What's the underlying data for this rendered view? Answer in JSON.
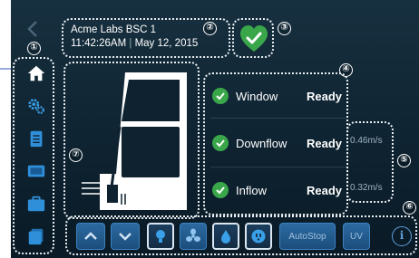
{
  "header": {
    "device_name": "Acme Labs BSC 1",
    "time": "11:42:26AM",
    "separator": "|",
    "date": "May 12, 2015"
  },
  "callouts": [
    "①",
    "②",
    "③",
    "④",
    "⑤",
    "⑥",
    "⑦"
  ],
  "sidebar": {
    "items": [
      {
        "icon": "home-icon",
        "active": true
      },
      {
        "icon": "gears-icon"
      },
      {
        "icon": "clipboard-icon"
      },
      {
        "icon": "monitor-icon"
      },
      {
        "icon": "folder-icon"
      },
      {
        "icon": "cards-icon"
      }
    ]
  },
  "status": {
    "items": [
      {
        "label": "Window",
        "value": "Ready"
      },
      {
        "label": "Downflow",
        "value": "Ready",
        "velocity": "0.46m/s"
      },
      {
        "label": "Inflow",
        "value": "Ready",
        "velocity": "0.32m/s"
      }
    ]
  },
  "bottom_bar": {
    "buttons": [
      {
        "icon": "chevron-up-icon"
      },
      {
        "icon": "chevron-down-icon"
      },
      {
        "icon": "light-bulb-icon",
        "selected": true
      },
      {
        "icon": "fan-icon"
      },
      {
        "icon": "drop-icon",
        "selected": true
      },
      {
        "icon": "outlet-icon",
        "selected": true
      }
    ],
    "autostop_label": "AutoStop",
    "uv_label": "UV",
    "info_label": "i"
  },
  "colors": {
    "background": "#0e2230",
    "accent_blue": "#2c6aa0",
    "status_green": "#3aa64a",
    "text": "#ffffff"
  }
}
